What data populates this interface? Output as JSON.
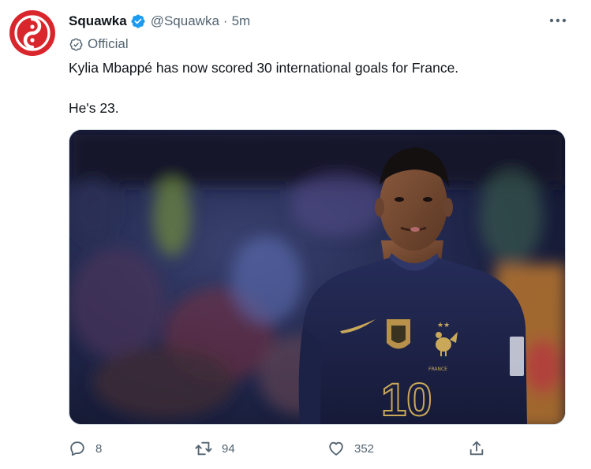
{
  "account": {
    "name": "Squawka",
    "handle": "@Squawka",
    "separator": "·",
    "time": "5m",
    "label": "Official"
  },
  "tweet": {
    "line1": "Kylia Mbappé has now scored 30 international goals for France.",
    "line2": "He's 23."
  },
  "media": {
    "jersey_number": "10",
    "brand_color": "#d9262c"
  },
  "actions": {
    "replies": "8",
    "retweets": "94",
    "likes": "352"
  },
  "icons": [
    "squawka-logo-icon",
    "verified-badge-icon",
    "more-options-icon",
    "official-check-icon",
    "reply-icon",
    "retweet-icon",
    "like-icon",
    "share-icon"
  ],
  "colors": {
    "verified": "#1d9bf0",
    "muted": "#536471",
    "text": "#0f1419"
  }
}
